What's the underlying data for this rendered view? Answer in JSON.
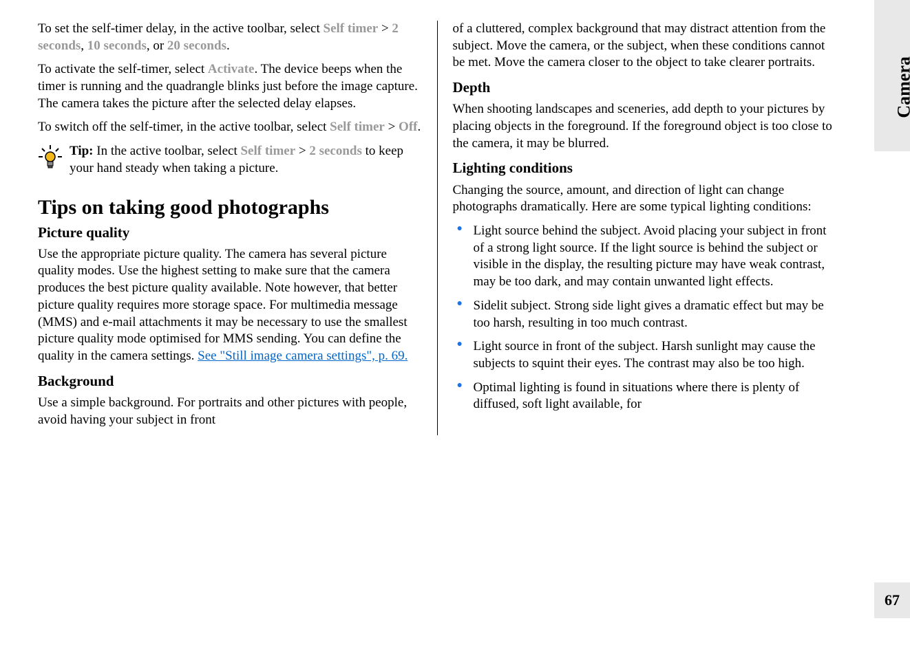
{
  "side": {
    "label": "Camera",
    "page_number": "67"
  },
  "left": {
    "p1_a": "To set the self-timer delay, in the active toolbar, select ",
    "p1_b": "Self timer",
    "p1_c": " > ",
    "p1_d": "2 seconds",
    "p1_e": ", ",
    "p1_f": "10 seconds",
    "p1_g": ", or ",
    "p1_h": "20 seconds",
    "p1_i": ".",
    "p2_a": "To activate the self-timer, select ",
    "p2_b": "Activate",
    "p2_c": ". The device beeps when the timer is running and the quadrangle blinks just before the image capture. The camera takes the picture after the selected delay elapses.",
    "p3_a": "To switch off the self-timer, in the active toolbar, select ",
    "p3_b": "Self timer",
    "p3_c": " > ",
    "p3_d": "Off",
    "p3_e": ".",
    "tip_a": "Tip: ",
    "tip_b": "In the active toolbar, select ",
    "tip_c": "Self timer",
    "tip_d": " > ",
    "tip_e": "2 seconds",
    "tip_f": " to keep your hand steady when taking a picture.",
    "h2": "Tips on taking good photographs",
    "h3_quality": "Picture quality",
    "p_quality_a": "Use the appropriate picture quality. The camera has several picture quality modes. Use the highest setting to make sure that the camera produces the best picture quality available. Note however, that better picture quality requires more storage space. For multimedia message (MMS) and e-mail attachments it may be necessary to use the smallest picture quality mode optimised for MMS sending. You can define the quality in the camera settings. ",
    "link_text": "See \"Still image camera settings\", p. 69.",
    "h3_bg": "Background",
    "p_bg": "Use a simple background. For portraits and other pictures with people, avoid having your subject in front"
  },
  "right": {
    "p_bg_cont": "of a cluttered, complex background that may distract attention from the subject. Move the camera, or the subject, when these conditions cannot be met. Move the camera closer to the object to take clearer portraits.",
    "h3_depth": "Depth",
    "p_depth": "When shooting landscapes and sceneries, add depth to your pictures by placing objects in the foreground. If the foreground object is too close to the camera, it may be blurred.",
    "h3_light": "Lighting conditions",
    "p_light": "Changing the source, amount, and direction of light can change photographs dramatically. Here are some typical lighting conditions:",
    "bullets": [
      "Light source behind the subject. Avoid placing your subject in front of a strong light source. If the light source is behind the subject or visible in the display, the resulting picture may have weak contrast, may be too dark, and may contain unwanted light effects.",
      "Sidelit subject. Strong side light gives a dramatic effect but may be too harsh, resulting in too much contrast.",
      "Light source in front of the subject. Harsh sunlight may cause the subjects to squint their eyes. The contrast may also be too high.",
      "Optimal lighting is found in situations where there is plenty of diffused, soft light available, for"
    ]
  }
}
